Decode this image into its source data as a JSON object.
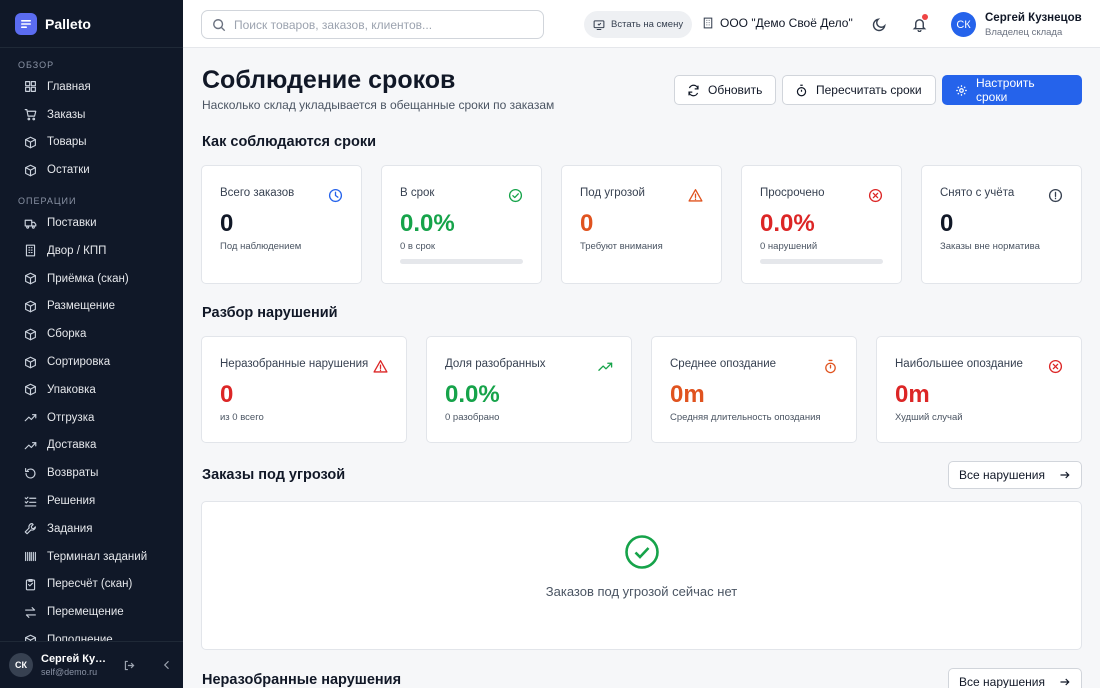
{
  "app": {
    "name": "Palleto"
  },
  "sidebar": {
    "sections": [
      {
        "title": "ОБЗОР",
        "items": [
          {
            "label": "Главная",
            "icon": "grid-icon"
          },
          {
            "label": "Заказы",
            "icon": "cart-icon"
          },
          {
            "label": "Товары",
            "icon": "box-icon"
          },
          {
            "label": "Остатки",
            "icon": "box-icon"
          }
        ]
      },
      {
        "title": "ОПЕРАЦИИ",
        "items": [
          {
            "label": "Поставки",
            "icon": "truck-icon"
          },
          {
            "label": "Двор / КПП",
            "icon": "building-icon"
          },
          {
            "label": "Приёмка (скан)",
            "icon": "box-icon"
          },
          {
            "label": "Размещение",
            "icon": "box-icon"
          },
          {
            "label": "Сборка",
            "icon": "box-icon"
          },
          {
            "label": "Сортировка",
            "icon": "box-icon"
          },
          {
            "label": "Упаковка",
            "icon": "box-icon"
          },
          {
            "label": "Отгрузка",
            "icon": "trend-icon"
          },
          {
            "label": "Доставка",
            "icon": "trend-icon"
          },
          {
            "label": "Возвраты",
            "icon": "return-icon"
          },
          {
            "label": "Решения",
            "icon": "list-check-icon"
          },
          {
            "label": "Задания",
            "icon": "wrench-icon"
          },
          {
            "label": "Терминал заданий",
            "icon": "barcode-icon"
          },
          {
            "label": "Пересчёт (скан)",
            "icon": "clipboard-icon"
          },
          {
            "label": "Перемещение",
            "icon": "swap-icon"
          },
          {
            "label": "Пополнение",
            "icon": "box-icon"
          }
        ]
      }
    ],
    "user": {
      "initials": "СК",
      "name": "Сергей Кузнецов",
      "email": "self@demo.ru"
    }
  },
  "header": {
    "search_placeholder": "Поиск товаров, заказов, клиентов...",
    "shift_button": "Встать на смену",
    "org": "ООО \"Демо Своё Дело\"",
    "user": {
      "initials": "СК",
      "name": "Сергей Кузнецов",
      "role": "Владелец склада"
    }
  },
  "page": {
    "title": "Соблюдение сроков",
    "subtitle": "Насколько склад укладывается в обещанные сроки по заказам",
    "buttons": {
      "refresh": "Обновить",
      "recalc": "Пересчитать сроки",
      "configure": "Настроить сроки"
    }
  },
  "compliance": {
    "title": "Как соблюдаются сроки",
    "cards": [
      {
        "label": "Всего заказов",
        "value": "0",
        "sub": "Под наблюдением",
        "icon": "clock-icon",
        "color": "#2563eb",
        "tone": "dark"
      },
      {
        "label": "В срок",
        "value": "0.0%",
        "sub": "0 в срок",
        "icon": "check-circle-icon",
        "color": "#16a34a",
        "tone": "green",
        "progress": 0
      },
      {
        "label": "Под угрозой",
        "value": "0",
        "sub": "Требуют внимания",
        "icon": "warning-icon",
        "color": "#e0531f",
        "tone": "orange"
      },
      {
        "label": "Просрочено",
        "value": "0.0%",
        "sub": "0 нарушений",
        "icon": "x-circle-icon",
        "color": "#dc2626",
        "tone": "red",
        "progress": 0
      },
      {
        "label": "Снято с учёта",
        "value": "0",
        "sub": "Заказы вне норматива",
        "icon": "info-circle-icon",
        "color": "#374151",
        "tone": "dark"
      }
    ]
  },
  "violations": {
    "title": "Разбор нарушений",
    "cards": [
      {
        "label": "Неразобранные нарушения",
        "value": "0",
        "sub": "из 0 всего",
        "icon": "warning-icon",
        "color": "#dc2626",
        "tone": "red"
      },
      {
        "label": "Доля разобранных",
        "value": "0.0%",
        "sub": "0 разобрано",
        "icon": "trend-up-icon",
        "color": "#16a34a",
        "tone": "green"
      },
      {
        "label": "Среднее опоздание",
        "value": "0m",
        "sub": "Средняя длительность опоздания",
        "icon": "timer-icon",
        "color": "#e0531f",
        "tone": "orange"
      },
      {
        "label": "Наибольшее опоздание",
        "value": "0m",
        "sub": "Худший случай",
        "icon": "x-circle-icon",
        "color": "#dc2626",
        "tone": "red"
      }
    ]
  },
  "at_risk": {
    "title": "Заказы под угрозой",
    "link": "Все нарушения",
    "empty": "Заказов под угрозой сейчас нет"
  },
  "unresolved": {
    "title": "Неразобранные нарушения",
    "link": "Все нарушения"
  }
}
